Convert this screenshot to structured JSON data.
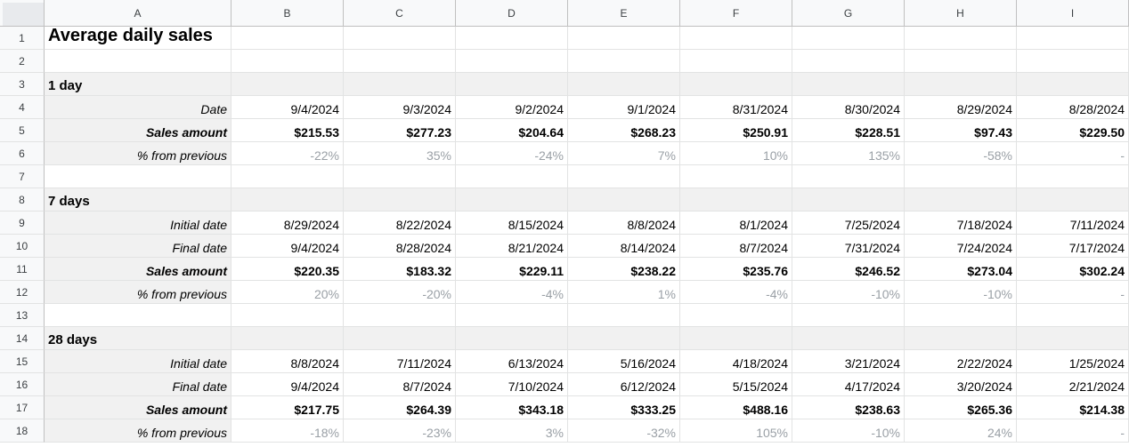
{
  "columns": [
    "A",
    "B",
    "C",
    "D",
    "E",
    "F",
    "G",
    "H",
    "I"
  ],
  "rows": [
    "1",
    "2",
    "3",
    "4",
    "5",
    "6",
    "7",
    "8",
    "9",
    "10",
    "11",
    "12",
    "13",
    "14",
    "15",
    "16",
    "17",
    "18"
  ],
  "title": "Average daily sales",
  "sections": [
    {
      "name": "1 day",
      "rows": [
        {
          "label": "Date",
          "style": "label",
          "values": [
            "9/4/2024",
            "9/3/2024",
            "9/2/2024",
            "9/1/2024",
            "8/31/2024",
            "8/30/2024",
            "8/29/2024",
            "8/28/2024"
          ]
        },
        {
          "label": "Sales amount",
          "style": "bold",
          "values": [
            "$215.53",
            "$277.23",
            "$204.64",
            "$268.23",
            "$250.91",
            "$228.51",
            "$97.43",
            "$229.50"
          ]
        },
        {
          "label": "% from previous",
          "style": "pct",
          "values": [
            "-22%",
            "35%",
            "-24%",
            "7%",
            "10%",
            "135%",
            "-58%",
            "-"
          ]
        }
      ]
    },
    {
      "name": "7 days",
      "rows": [
        {
          "label": "Initial date",
          "style": "label",
          "values": [
            "8/29/2024",
            "8/22/2024",
            "8/15/2024",
            "8/8/2024",
            "8/1/2024",
            "7/25/2024",
            "7/18/2024",
            "7/11/2024"
          ]
        },
        {
          "label": "Final date",
          "style": "label",
          "values": [
            "9/4/2024",
            "8/28/2024",
            "8/21/2024",
            "8/14/2024",
            "8/7/2024",
            "7/31/2024",
            "7/24/2024",
            "7/17/2024"
          ]
        },
        {
          "label": "Sales amount",
          "style": "bold",
          "values": [
            "$220.35",
            "$183.32",
            "$229.11",
            "$238.22",
            "$235.76",
            "$246.52",
            "$273.04",
            "$302.24"
          ]
        },
        {
          "label": "% from previous",
          "style": "pct",
          "values": [
            "20%",
            "-20%",
            "-4%",
            "1%",
            "-4%",
            "-10%",
            "-10%",
            "-"
          ]
        }
      ]
    },
    {
      "name": "28 days",
      "rows": [
        {
          "label": "Initial date",
          "style": "label",
          "values": [
            "8/8/2024",
            "7/11/2024",
            "6/13/2024",
            "5/16/2024",
            "4/18/2024",
            "3/21/2024",
            "2/22/2024",
            "1/25/2024"
          ]
        },
        {
          "label": "Final date",
          "style": "label",
          "values": [
            "9/4/2024",
            "8/7/2024",
            "7/10/2024",
            "6/12/2024",
            "5/15/2024",
            "4/17/2024",
            "3/20/2024",
            "2/21/2024"
          ]
        },
        {
          "label": "Sales amount",
          "style": "bold",
          "values": [
            "$217.75",
            "$264.39",
            "$343.18",
            "$333.25",
            "$488.16",
            "$238.63",
            "$265.36",
            "$214.38"
          ]
        },
        {
          "label": "% from previous",
          "style": "pct",
          "values": [
            "-18%",
            "-23%",
            "3%",
            "-32%",
            "105%",
            "-10%",
            "24%",
            "-"
          ]
        }
      ]
    }
  ]
}
